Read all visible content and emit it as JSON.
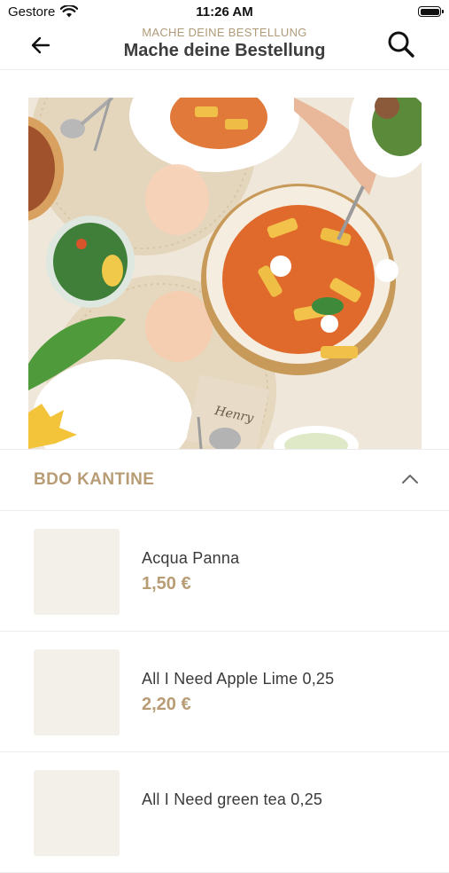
{
  "status_bar": {
    "carrier": "Gestore",
    "time": "11:26 AM",
    "icons": [
      "wifi-icon",
      "battery-icon"
    ]
  },
  "header": {
    "subtitle": "MACHE DEINE BESTELLUNG",
    "title": "Mache deine Bestellung",
    "back_icon": "arrow-left-icon",
    "search_icon": "search-icon"
  },
  "section": {
    "title": "BDO KANTINE",
    "icon": "chevron-up-icon"
  },
  "menu_items": [
    {
      "name": "Acqua Panna",
      "price": "1,50 €"
    },
    {
      "name": "All I Need Apple Lime 0,25",
      "price": "2,20 €"
    },
    {
      "name": "All I Need green tea 0,25",
      "price": ""
    }
  ],
  "colors": {
    "accent": "#b89c75",
    "subtitle": "#b09a78",
    "thumb_bg": "#f3f0e9",
    "divider": "#ececec"
  }
}
